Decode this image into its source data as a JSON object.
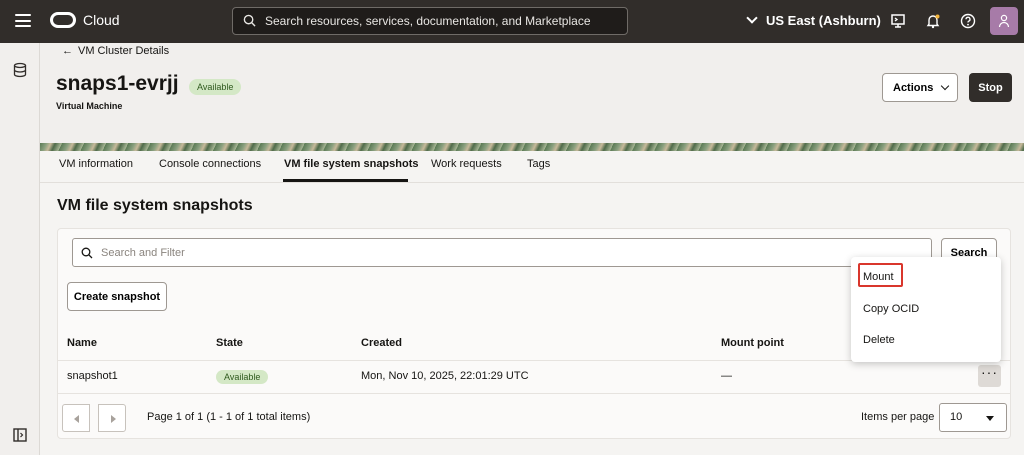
{
  "nav": {
    "brand": "Cloud",
    "search_text": "Search resources, services, documentation, and Marketplace",
    "region": "US East (Ashburn)"
  },
  "header": {
    "back_label": "VM Cluster Details",
    "title": "snaps1-evrjj",
    "status": "Available",
    "subtitle": "Virtual Machine",
    "actions_label": "Actions",
    "stop_label": "Stop"
  },
  "tabs": [
    {
      "label": "VM information"
    },
    {
      "label": "Console connections"
    },
    {
      "label": "VM file system snapshots",
      "active": true
    },
    {
      "label": "Work requests"
    },
    {
      "label": "Tags"
    }
  ],
  "section": {
    "title": "VM file system snapshots",
    "filter_placeholder": "Search and Filter",
    "search_label": "Search",
    "create_label": "Create snapshot"
  },
  "table": {
    "columns": [
      "Name",
      "State",
      "Created",
      "Mount point"
    ],
    "rows": [
      {
        "name": "snapshot1",
        "state": "Available",
        "created": "Mon, Nov 10, 2025, 22:01:29 UTC",
        "mount_point": "—"
      }
    ]
  },
  "pagination": {
    "summary": "Page 1 of 1 (1 - 1 of 1 total items)",
    "items_per_page_label": "Items per page",
    "items_per_page": "10"
  },
  "menu": {
    "items": [
      "Mount",
      "Copy OCID",
      "Delete"
    ],
    "highlighted": "Mount",
    "highlight_color": "#d9362c"
  },
  "colors": {
    "topbar": "#312d2a",
    "badge_bg": "#d4e8c6",
    "badge_text": "#2f5a1e",
    "avatar": "#a77ba8"
  }
}
